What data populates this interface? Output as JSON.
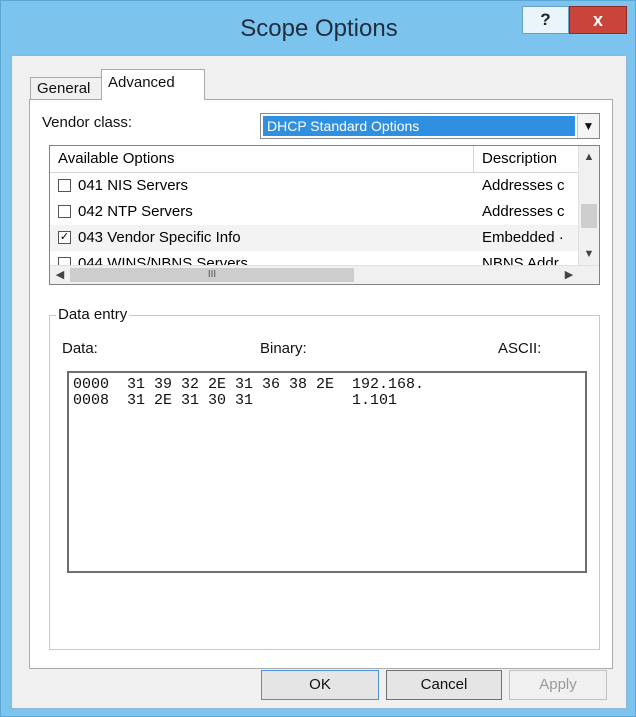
{
  "window": {
    "title": "Scope Options",
    "help_label": "?",
    "close_label": "x"
  },
  "tabs": [
    {
      "label": "General",
      "active": false
    },
    {
      "label": "Advanced",
      "active": true
    }
  ],
  "vendor_class": {
    "label": "Vendor class:",
    "selected": "DHCP Standard Options"
  },
  "options_list": {
    "columns": [
      "Available Options",
      "Description"
    ],
    "rows": [
      {
        "name": "041 NIS Servers",
        "description": "Addresses c",
        "checked": false
      },
      {
        "name": "042 NTP Servers",
        "description": "Addresses c",
        "checked": false
      },
      {
        "name": "043 Vendor Specific Info",
        "description": "Embedded ·",
        "checked": true
      },
      {
        "name": "044 WINS/NBNS Servers",
        "description": "NBNS Addr",
        "checked": false
      }
    ],
    "hscroll_grip": "III"
  },
  "data_entry": {
    "group_label": "Data entry",
    "data_label": "Data:",
    "binary_label": "Binary:",
    "ascii_label": "ASCII:",
    "lines": [
      "0000  31 39 32 2E 31 36 38 2E  192.168.",
      "0008  31 2E 31 30 31           1.101"
    ]
  },
  "buttons": {
    "ok": "OK",
    "cancel": "Cancel",
    "apply": "Apply"
  },
  "colors": {
    "frame": "#7cc4ee",
    "selection": "#2f8fe0",
    "close": "#c9453c"
  }
}
